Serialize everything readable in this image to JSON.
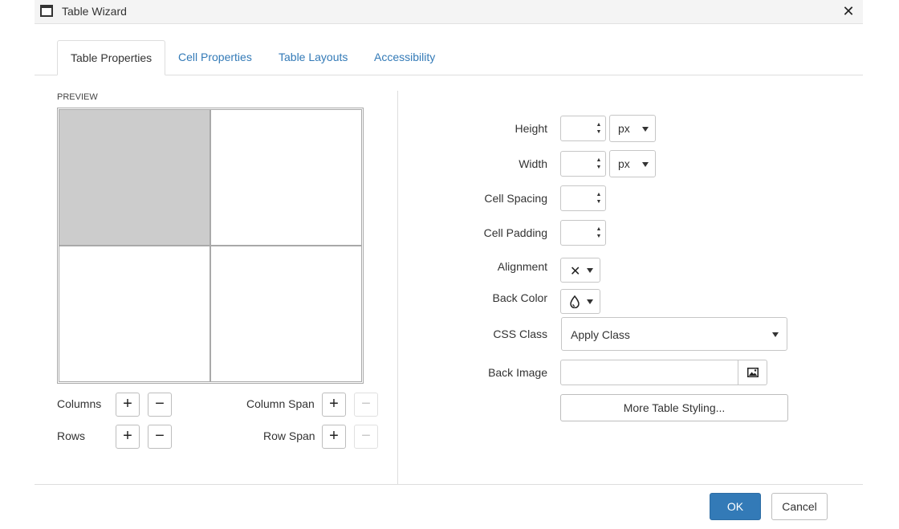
{
  "window": {
    "title": "Table Wizard",
    "close_glyph": "✕"
  },
  "tabs": [
    {
      "label": "Table Properties",
      "active": true
    },
    {
      "label": "Cell Properties",
      "active": false
    },
    {
      "label": "Table Layouts",
      "active": false
    },
    {
      "label": "Accessibility",
      "active": false
    }
  ],
  "preview": {
    "label": "Preview",
    "rows": 2,
    "columns": 2,
    "selected_cell": [
      0,
      0
    ],
    "selected_color": "#cccccc"
  },
  "table_controls": {
    "columns_label": "Columns",
    "rows_label": "Rows",
    "column_span_label": "Column Span",
    "row_span_label": "Row Span",
    "plus_glyph": "+",
    "minus_glyph": "−",
    "span_minus_disabled": true
  },
  "properties": {
    "height_label": "Height",
    "height_value": "",
    "height_unit": "px",
    "width_label": "Width",
    "width_value": "",
    "width_unit": "px",
    "cell_spacing_label": "Cell Spacing",
    "cell_spacing_value": "",
    "cell_padding_label": "Cell Padding",
    "cell_padding_value": "",
    "alignment_label": "Alignment",
    "alignment_glyph": "✕",
    "back_color_label": "Back Color",
    "back_color_icon": "color-drop-icon",
    "css_class_label": "CSS Class",
    "css_class_value": "Apply Class",
    "back_image_label": "Back Image",
    "back_image_value": "",
    "back_image_icon": "image-icon",
    "more_styling_label": "More Table Styling..."
  },
  "footer": {
    "ok_label": "OK",
    "cancel_label": "Cancel"
  },
  "colors": {
    "primary": "#337ab7",
    "link": "#337ab7",
    "border": "#dddddd"
  }
}
